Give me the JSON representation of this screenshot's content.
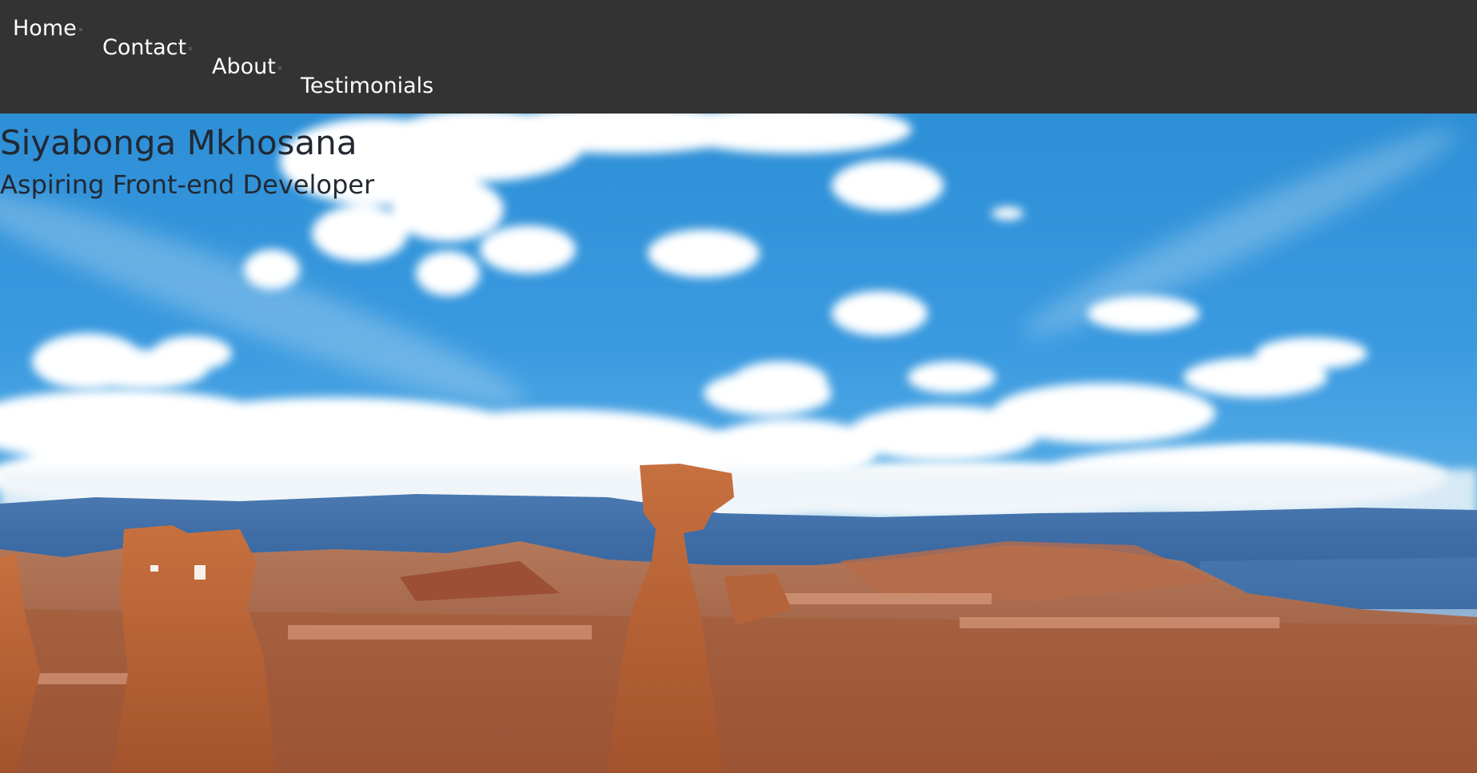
{
  "nav": {
    "items": [
      {
        "label": "Home"
      },
      {
        "label": "Contact"
      },
      {
        "label": "About"
      },
      {
        "label": "Testimonials"
      }
    ]
  },
  "hero": {
    "name": "Siyabonga Mkhosana",
    "tagline": "Aspiring Front-end Developer"
  },
  "colors": {
    "navbar_bg": "#333333",
    "nav_text": "#ffffff",
    "hero_text": "#222833"
  }
}
